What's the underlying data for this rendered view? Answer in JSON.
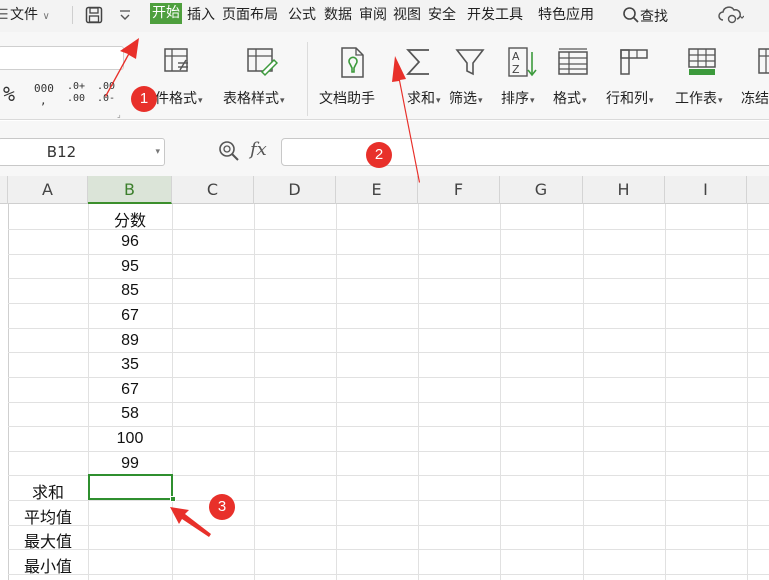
{
  "menu": {
    "file": "文件",
    "tabs": [
      "开始",
      "插入",
      "页面布局",
      "公式",
      "数据",
      "审阅",
      "视图",
      "安全",
      "开发工具",
      "特色应用"
    ],
    "active_tab": "开始",
    "search": "查找"
  },
  "ribbon": {
    "number_format": {
      "percent": "%",
      "thousands": "000",
      "inc_decimal_top": ".0+",
      "inc_decimal_bottom": ".00",
      "dec_decimal_top": ".00",
      "dec_decimal_bottom": ".0-"
    },
    "buttons": {
      "conditional_format": "件格式",
      "table_style": "表格样式",
      "doc_helper": "文档助手",
      "sum": "求和",
      "filter": "筛选",
      "sort": "排序",
      "format": "格式",
      "row_col": "行和列",
      "worksheet": "工作表",
      "freeze": "冻结"
    }
  },
  "formula_bar": {
    "name_box": "B12",
    "fx": "fx",
    "formula": ""
  },
  "sheet": {
    "columns": [
      "A",
      "B",
      "C",
      "D",
      "E",
      "F",
      "G",
      "H",
      "I"
    ],
    "selected_column": "B",
    "header_b": "分数",
    "scores": [
      "96",
      "95",
      "85",
      "67",
      "89",
      "35",
      "67",
      "58",
      "100",
      "99"
    ],
    "row_labels": [
      "求和",
      "平均值",
      "最大值",
      "最小值"
    ],
    "active_cell": "B12"
  },
  "annotations": {
    "badge1": "1",
    "badge2": "2",
    "badge3": "3"
  },
  "colors": {
    "accent_green": "#4e9f3d",
    "annotation_red": "#e8302a",
    "selection_green": "#2f8f2f"
  }
}
